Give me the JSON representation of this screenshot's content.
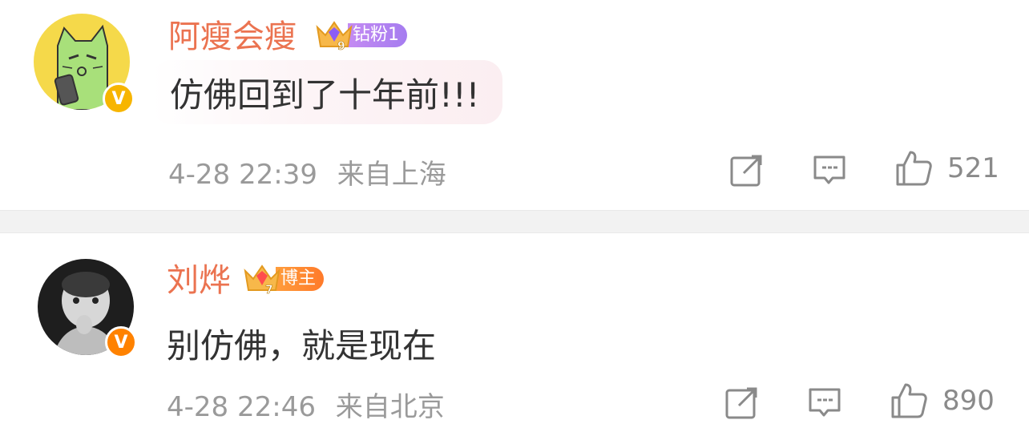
{
  "comments": [
    {
      "username": "阿瘦会瘦",
      "badge_level": "9",
      "badge_label": "钻粉1",
      "verified_mark": "V",
      "text": "仿佛回到了十年前!!!",
      "timestamp": "4-28 22:39",
      "location": "来自上海",
      "like_count": "521",
      "colors": {
        "username": "#eb7350",
        "badge": "#b784f1",
        "verified": "#f7b500"
      }
    },
    {
      "username": "刘烨",
      "badge_level": "7",
      "badge_label": "博主",
      "verified_mark": "V",
      "text": "别仿佛，就是现在",
      "timestamp": "4-28 22:46",
      "location": "来自北京",
      "like_count": "890",
      "colors": {
        "username": "#eb7350",
        "badge": "#ff8a30",
        "verified": "#ff8200"
      }
    }
  ],
  "icons": [
    "share-icon",
    "comment-icon",
    "like-icon"
  ]
}
